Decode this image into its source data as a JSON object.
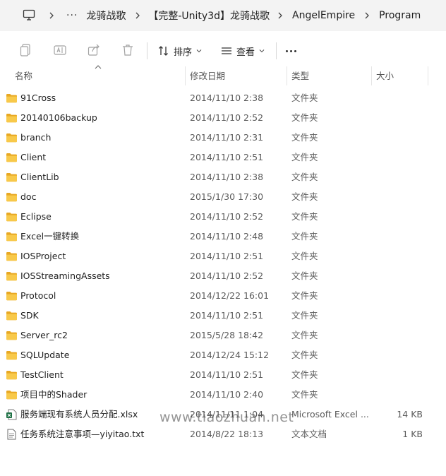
{
  "address_bar": {
    "more": "···",
    "segments": [
      "龙骑战歌",
      "【完整-Unity3d】龙骑战歌",
      "AngelEmpire",
      "Program"
    ]
  },
  "toolbar": {
    "sort_label": "排序",
    "view_label": "查看"
  },
  "columns": {
    "name": "名称",
    "date": "修改日期",
    "type": "类型",
    "size": "大小"
  },
  "files": [
    {
      "name": "91Cross",
      "date": "2014/11/10 2:38",
      "type": "文件夹",
      "size": "",
      "icon": "folder-icon"
    },
    {
      "name": "20140106backup",
      "date": "2014/11/10 2:52",
      "type": "文件夹",
      "size": "",
      "icon": "folder-icon"
    },
    {
      "name": "branch",
      "date": "2014/11/10 2:31",
      "type": "文件夹",
      "size": "",
      "icon": "folder-icon"
    },
    {
      "name": "Client",
      "date": "2014/11/10 2:51",
      "type": "文件夹",
      "size": "",
      "icon": "folder-icon"
    },
    {
      "name": "ClientLib",
      "date": "2014/11/10 2:38",
      "type": "文件夹",
      "size": "",
      "icon": "folder-icon"
    },
    {
      "name": "doc",
      "date": "2015/1/30 17:30",
      "type": "文件夹",
      "size": "",
      "icon": "folder-icon"
    },
    {
      "name": "Eclipse",
      "date": "2014/11/10 2:52",
      "type": "文件夹",
      "size": "",
      "icon": "folder-icon"
    },
    {
      "name": "Excel一键转换",
      "date": "2014/11/10 2:48",
      "type": "文件夹",
      "size": "",
      "icon": "folder-icon"
    },
    {
      "name": "IOSProject",
      "date": "2014/11/10 2:51",
      "type": "文件夹",
      "size": "",
      "icon": "folder-icon"
    },
    {
      "name": "IOSStreamingAssets",
      "date": "2014/11/10 2:52",
      "type": "文件夹",
      "size": "",
      "icon": "folder-icon"
    },
    {
      "name": "Protocol",
      "date": "2014/12/22 16:01",
      "type": "文件夹",
      "size": "",
      "icon": "folder-icon"
    },
    {
      "name": "SDK",
      "date": "2014/11/10 2:51",
      "type": "文件夹",
      "size": "",
      "icon": "folder-icon"
    },
    {
      "name": "Server_rc2",
      "date": "2015/5/28 18:42",
      "type": "文件夹",
      "size": "",
      "icon": "folder-icon"
    },
    {
      "name": "SQLUpdate",
      "date": "2014/12/24 15:12",
      "type": "文件夹",
      "size": "",
      "icon": "folder-icon"
    },
    {
      "name": "TestClient",
      "date": "2014/11/10 2:51",
      "type": "文件夹",
      "size": "",
      "icon": "folder-icon"
    },
    {
      "name": "项目中的Shader",
      "date": "2014/11/10 2:40",
      "type": "文件夹",
      "size": "",
      "icon": "folder-icon"
    },
    {
      "name": "服务端现有系统人员分配.xlsx",
      "date": "2014/11/11 1:04",
      "type": "Microsoft Excel ...",
      "size": "14 KB",
      "icon": "excel-file-icon"
    },
    {
      "name": "任务系统注意事项—yiyitao.txt",
      "date": "2014/8/22 18:13",
      "type": "文本文档",
      "size": "1 KB",
      "icon": "text-file-icon"
    }
  ],
  "watermark": "www.tiaozhuan.net"
}
